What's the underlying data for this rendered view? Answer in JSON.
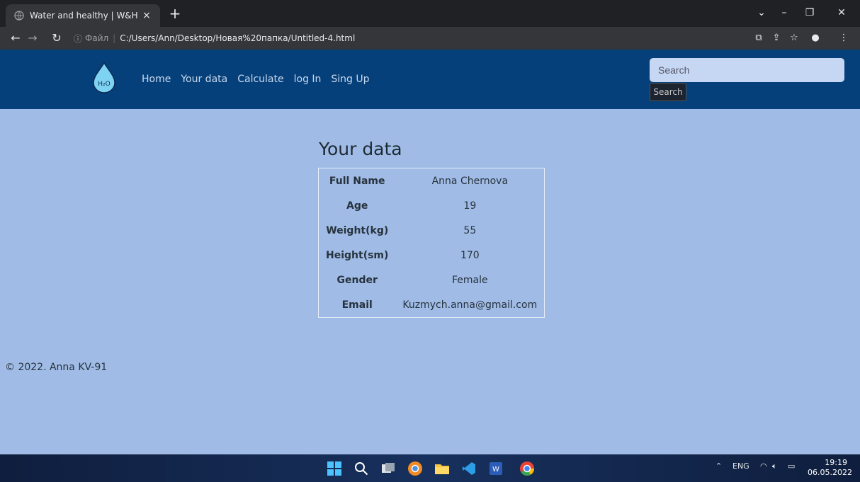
{
  "browser": {
    "tab_title": "Water and healthy | W&H",
    "tab_close": "×",
    "new_tab": "+",
    "address_scheme": "Файл",
    "address_url": "C:/Users/Ann/Desktop/Новая%20папка/Untitled-4.html"
  },
  "navbar": {
    "logo_text": "H2O",
    "links": [
      "Home",
      "Your data",
      "Calculate",
      "log In",
      "Sing Up"
    ],
    "search_placeholder": "Search",
    "search_button": "Search"
  },
  "main": {
    "heading": "Your data",
    "rows": [
      {
        "label": "Full Name",
        "value": "Anna Chernova"
      },
      {
        "label": "Age",
        "value": "19"
      },
      {
        "label": "Weight(kg)",
        "value": "55"
      },
      {
        "label": "Height(sm)",
        "value": "170"
      },
      {
        "label": "Gender",
        "value": "Female"
      },
      {
        "label": "Email",
        "value": "Kuzmych.anna@gmail.com"
      }
    ]
  },
  "footer": {
    "text": "© 2022. Anna KV-91"
  },
  "taskbar": {
    "lang": "ENG",
    "time": "19:19",
    "date": "06.05.2022"
  },
  "colors": {
    "navbar": "#06407a",
    "page_bg": "#a0bce6",
    "chrome_dark": "#202124",
    "toolbar": "#35363a"
  }
}
